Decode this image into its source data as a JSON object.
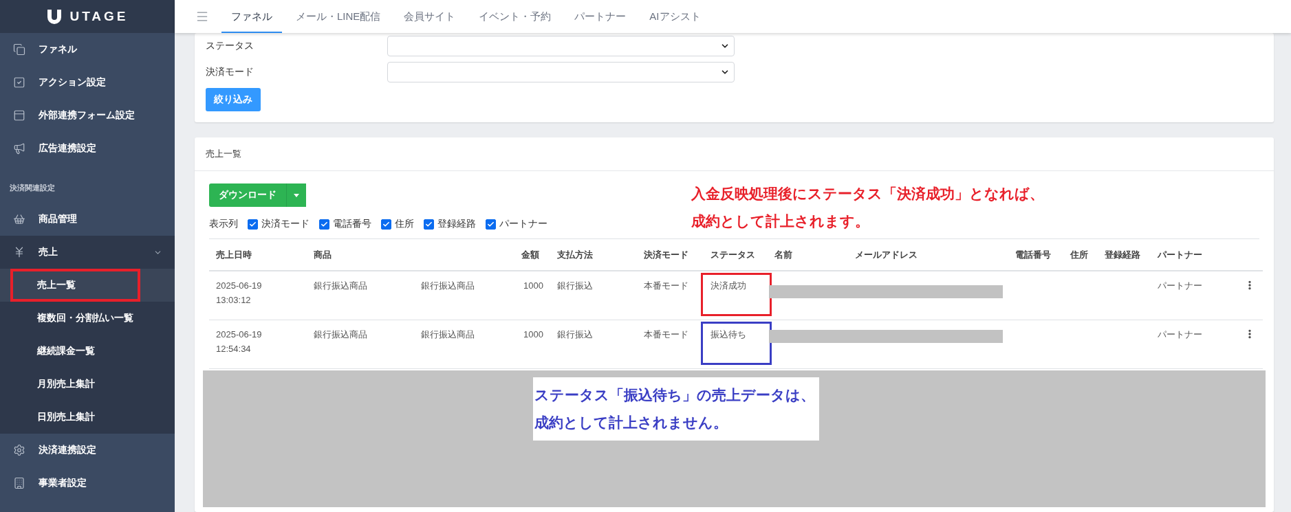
{
  "logo": {
    "text": "UTAGE"
  },
  "sidebar": {
    "items": [
      {
        "label": "ファネル",
        "kind": "link"
      },
      {
        "label": "アクション設定",
        "kind": "link"
      },
      {
        "label": "外部連携フォーム設定",
        "kind": "link"
      },
      {
        "label": "広告連携設定",
        "kind": "link"
      },
      {
        "label": "決済関連設定",
        "kind": "section"
      },
      {
        "label": "商品管理",
        "kind": "link"
      },
      {
        "label": "売上",
        "kind": "group",
        "expanded": true,
        "children": [
          {
            "label": "売上一覧",
            "selected": true
          },
          {
            "label": "複数回・分割払い一覧",
            "selected": false
          },
          {
            "label": "継続課金一覧",
            "selected": false
          },
          {
            "label": "月別売上集計",
            "selected": false
          },
          {
            "label": "日別売上集計",
            "selected": false
          }
        ]
      },
      {
        "label": "決済連携設定",
        "kind": "link"
      },
      {
        "label": "事業者設定",
        "kind": "link"
      }
    ]
  },
  "top_tabs": [
    {
      "label": "ファネル",
      "selected": true
    },
    {
      "label": "メール・LINE配信",
      "selected": false
    },
    {
      "label": "会員サイト",
      "selected": false
    },
    {
      "label": "イベント・予約",
      "selected": false
    },
    {
      "label": "パートナー",
      "selected": false
    },
    {
      "label": "AIアシスト",
      "selected": false
    }
  ],
  "filter": {
    "fields": [
      {
        "label": "ステータス"
      },
      {
        "label": "決済モード"
      }
    ],
    "button": "絞り込み"
  },
  "sales": {
    "title": "売上一覧",
    "download_button": "ダウンロード",
    "columns_label": "表示列",
    "column_toggles": [
      {
        "label": "決済モード",
        "checked": true
      },
      {
        "label": "電話番号",
        "checked": true
      },
      {
        "label": "住所",
        "checked": true
      },
      {
        "label": "登録経路",
        "checked": true
      },
      {
        "label": "パートナー",
        "checked": true
      }
    ],
    "table": {
      "columns": [
        "売上日時",
        "商品",
        "",
        "金額",
        "支払方法",
        "決済モード",
        "ステータス",
        "名前",
        "メールアドレス",
        "電話番号",
        "住所",
        "登録経路",
        "パートナー"
      ],
      "rows": [
        {
          "date": "2025-06-19",
          "time": "13:03:12",
          "product": "銀行振込商品",
          "product_2": "銀行振込商品",
          "amount": "1000",
          "payment": "銀行振込",
          "mode": "本番モード",
          "status": "決済成功",
          "contact_redacted": true,
          "partner": "パートナー",
          "color": "#e8202a"
        },
        {
          "date": "2025-06-19",
          "time": "12:54:34",
          "product": "銀行振込商品",
          "product_2": "銀行振込商品",
          "amount": "1000",
          "payment": "銀行振込",
          "mode": "本番モード",
          "status": "振込待ち",
          "contact_redacted": true,
          "partner": "パートナー",
          "color": "#3a3ec4"
        }
      ]
    },
    "rest_redacted": true
  },
  "annotations": [
    {
      "kind": "top",
      "color": "#e8202a",
      "lines": [
        "入金反映処理後にステータス「決済成功」となれば、",
        "成約として計上されます。"
      ]
    },
    {
      "kind": "bottom",
      "color": "#3a3ec4",
      "lines": [
        "ステータス「振込待ち」の売上データは、",
        "成約として計上されません。"
      ]
    }
  ]
}
